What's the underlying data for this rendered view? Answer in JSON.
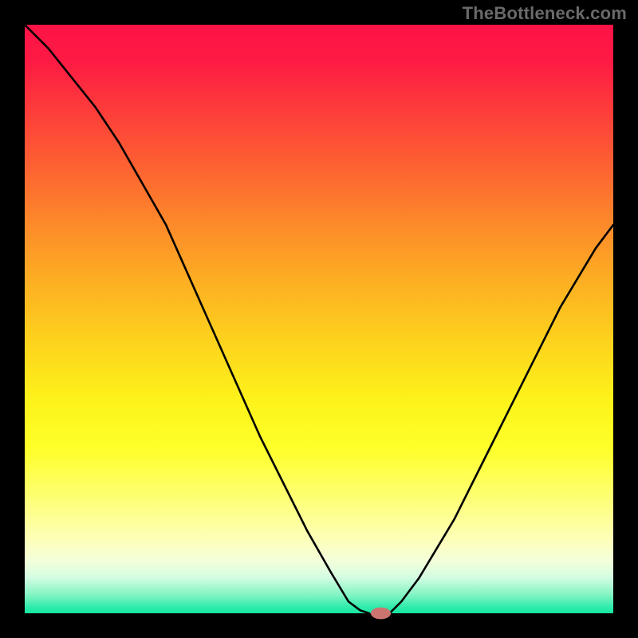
{
  "watermark": "TheBottleneck.com",
  "colors": {
    "curve": "#000000",
    "marker": "#cb7470",
    "page_bg": "#000000"
  },
  "chart_data": {
    "type": "line",
    "title": "",
    "xlabel": "",
    "ylabel": "",
    "xlim": [
      0,
      100
    ],
    "ylim": [
      0,
      100
    ],
    "grid": false,
    "legend": false,
    "annotations": [],
    "series": [
      {
        "name": "left-branch",
        "x": [
          0,
          4,
          8,
          12,
          16,
          20,
          24,
          28,
          32,
          36,
          40,
          44,
          48,
          52,
          55,
          57,
          58.5
        ],
        "y": [
          100,
          96,
          91,
          86,
          80,
          73,
          66,
          57,
          48,
          39,
          30,
          22,
          14,
          7,
          2,
          0.5,
          0
        ]
      },
      {
        "name": "right-branch",
        "x": [
          62,
          64,
          67,
          70,
          73,
          76,
          79,
          82,
          85,
          88,
          91,
          94,
          97,
          100
        ],
        "y": [
          0,
          2,
          6,
          11,
          16,
          22,
          28,
          34,
          40,
          46,
          52,
          57,
          62,
          66
        ]
      }
    ],
    "marker": {
      "x": 60.5,
      "y": 0,
      "rx": 1.7,
      "ry": 1.0
    },
    "background_gradient": {
      "direction": "top-to-bottom",
      "stops": [
        {
          "pos": 0,
          "color": "#fd1347"
        },
        {
          "pos": 24,
          "color": "#fd6132"
        },
        {
          "pos": 54,
          "color": "#fdd31d"
        },
        {
          "pos": 80,
          "color": "#feff70"
        },
        {
          "pos": 94,
          "color": "#d2fde2"
        },
        {
          "pos": 100,
          "color": "#17e7a3"
        }
      ]
    }
  }
}
